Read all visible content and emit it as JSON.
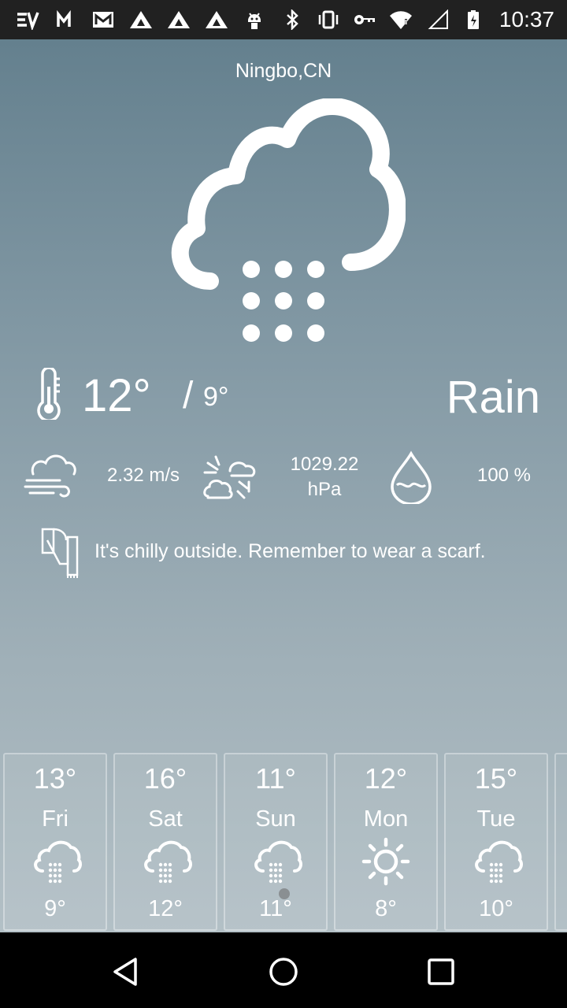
{
  "status_bar": {
    "time": "10:37",
    "left_icons": [
      "ev-icon",
      "gmail-m-icon",
      "mail-icon",
      "triangle-app-icon",
      "triangle-app-icon",
      "triangle-app-icon",
      "android-icon"
    ],
    "right_icons": [
      "bluetooth-icon",
      "vibrate-icon",
      "vpn-key-icon",
      "wifi-icon",
      "signal-icon",
      "battery-charging-icon"
    ]
  },
  "weather": {
    "city": "Ningbo,CN",
    "icon": "rain-cloud-icon",
    "temp_high": "12°",
    "temp_sep": "/",
    "temp_low": "9°",
    "condition": "Rain",
    "wind_speed": "2.32 m/s",
    "pressure_value": "1029.22",
    "pressure_unit": "hPa",
    "humidity": "100 %",
    "advice": "It's chilly outside. Remember to wear a scarf."
  },
  "forecast": [
    {
      "high": "13°",
      "day": "Fri",
      "low": "9°",
      "icon": "rain-cloud-icon"
    },
    {
      "high": "16°",
      "day": "Sat",
      "low": "12°",
      "icon": "rain-cloud-icon"
    },
    {
      "high": "11°",
      "day": "Sun",
      "low": "11°",
      "icon": "rain-cloud-icon"
    },
    {
      "high": "12°",
      "day": "Mon",
      "low": "8°",
      "icon": "sun-icon"
    },
    {
      "high": "15°",
      "day": "Tue",
      "low": "10°",
      "icon": "rain-cloud-icon"
    }
  ],
  "nav": [
    "back-icon",
    "home-icon",
    "recents-icon"
  ]
}
